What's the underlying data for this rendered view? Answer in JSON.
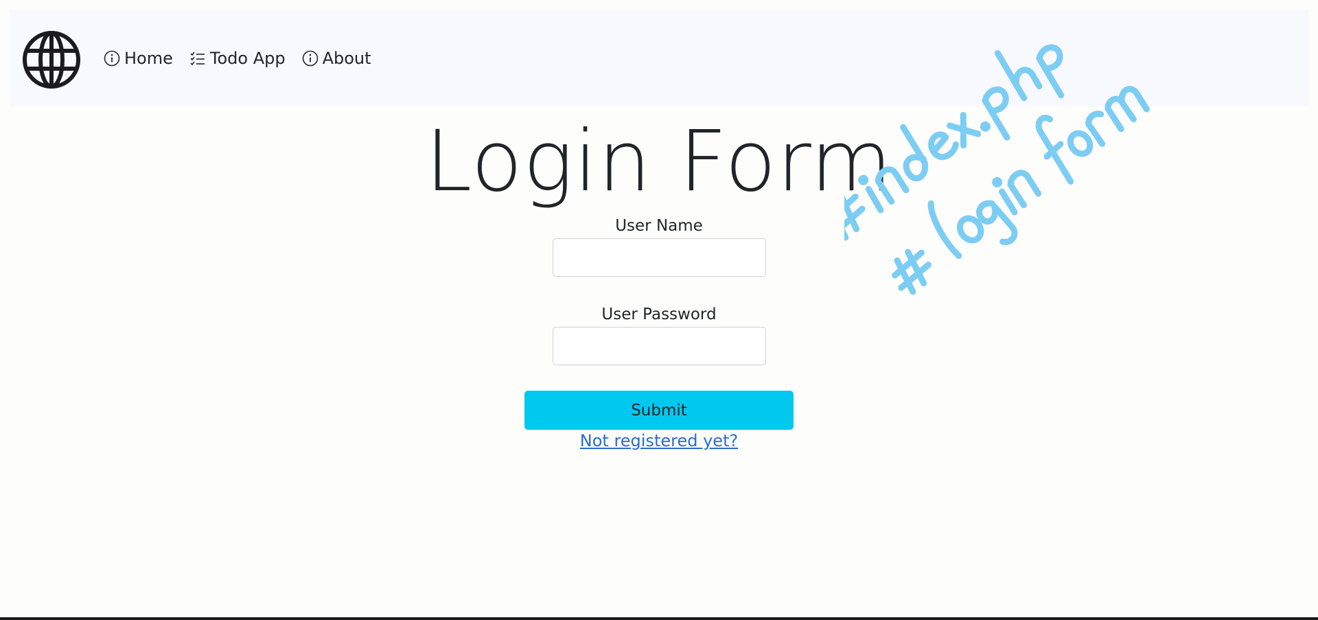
{
  "navbar": {
    "logo_icon": "globe-icon",
    "links": [
      {
        "label": "Home",
        "icon": "info-circle-icon"
      },
      {
        "label": "Todo App",
        "icon": "list-check-icon"
      },
      {
        "label": "About",
        "icon": "info-circle-icon"
      }
    ]
  },
  "main": {
    "title": "Login Form",
    "username_label": "User Name",
    "username_value": "",
    "password_label": "User Password",
    "password_value": "",
    "submit_label": "Submit",
    "register_link": "Not registered yet?"
  },
  "annotation": {
    "line1": "#index.php",
    "line2": "# login form",
    "color": "#7ccdf3"
  },
  "colors": {
    "navbar_bg": "#f8f9fe",
    "submit_bg": "#00c9ef",
    "link": "#2c6bd6"
  }
}
